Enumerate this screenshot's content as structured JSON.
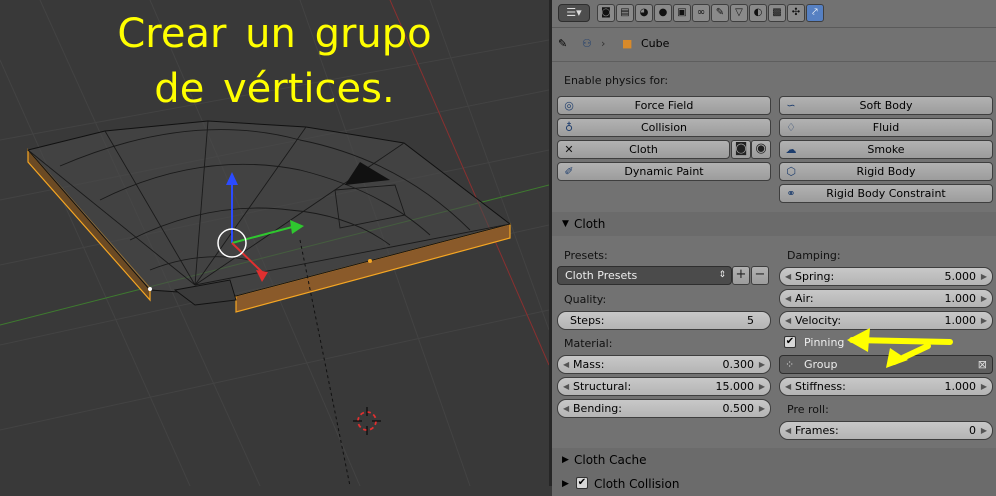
{
  "overlay": {
    "line1": "Crear un grupo",
    "line2": "de vértices."
  },
  "toolbar": {
    "editor_icon": "properties-editor-icon",
    "context_icons": [
      "render-icon",
      "render-layers-icon",
      "scene-icon",
      "world-icon",
      "object-icon",
      "constraints-icon",
      "modifiers-icon",
      "data-icon",
      "material-icon",
      "texture-icon",
      "particles-icon",
      "physics-icon"
    ],
    "active_icon": "physics-icon"
  },
  "breadcrumb": {
    "object": "Cube"
  },
  "physics": {
    "enable_label": "Enable physics for:",
    "buttons": {
      "force_field": "Force Field",
      "collision": "Collision",
      "cloth": "Cloth",
      "dynamic_paint": "Dynamic Paint",
      "soft_body": "Soft Body",
      "fluid": "Fluid",
      "smoke": "Smoke",
      "rigid_body": "Rigid Body",
      "rigid_body_constraint": "Rigid Body Constraint"
    }
  },
  "cloth_panel": {
    "title": "Cloth",
    "presets_label": "Presets:",
    "presets_value": "Cloth Presets",
    "quality_label": "Quality:",
    "steps_label": "Steps:",
    "steps_value": "5",
    "material_label": "Material:",
    "mass_label": "Mass:",
    "mass_value": "0.300",
    "structural_label": "Structural:",
    "structural_value": "15.000",
    "bending_label": "Bending:",
    "bending_value": "0.500",
    "damping_label": "Damping:",
    "spring_label": "Spring:",
    "spring_value": "5.000",
    "air_label": "Air:",
    "air_value": "1.000",
    "velocity_label": "Velocity:",
    "velocity_value": "1.000",
    "pinning_label": "Pinning",
    "pinning_checked": true,
    "group_value": "Group",
    "stiffness_label": "Stiffness:",
    "stiffness_value": "1.000",
    "preroll_label": "Pre roll:",
    "frames_label": "Frames:",
    "frames_value": "0"
  },
  "sections": {
    "cloth_cache": "Cloth Cache",
    "cloth_collision": "Cloth Collision"
  },
  "colors": {
    "annotation": "#ffff00",
    "selection": "#f5a623",
    "active_tab": "#5680c2"
  }
}
